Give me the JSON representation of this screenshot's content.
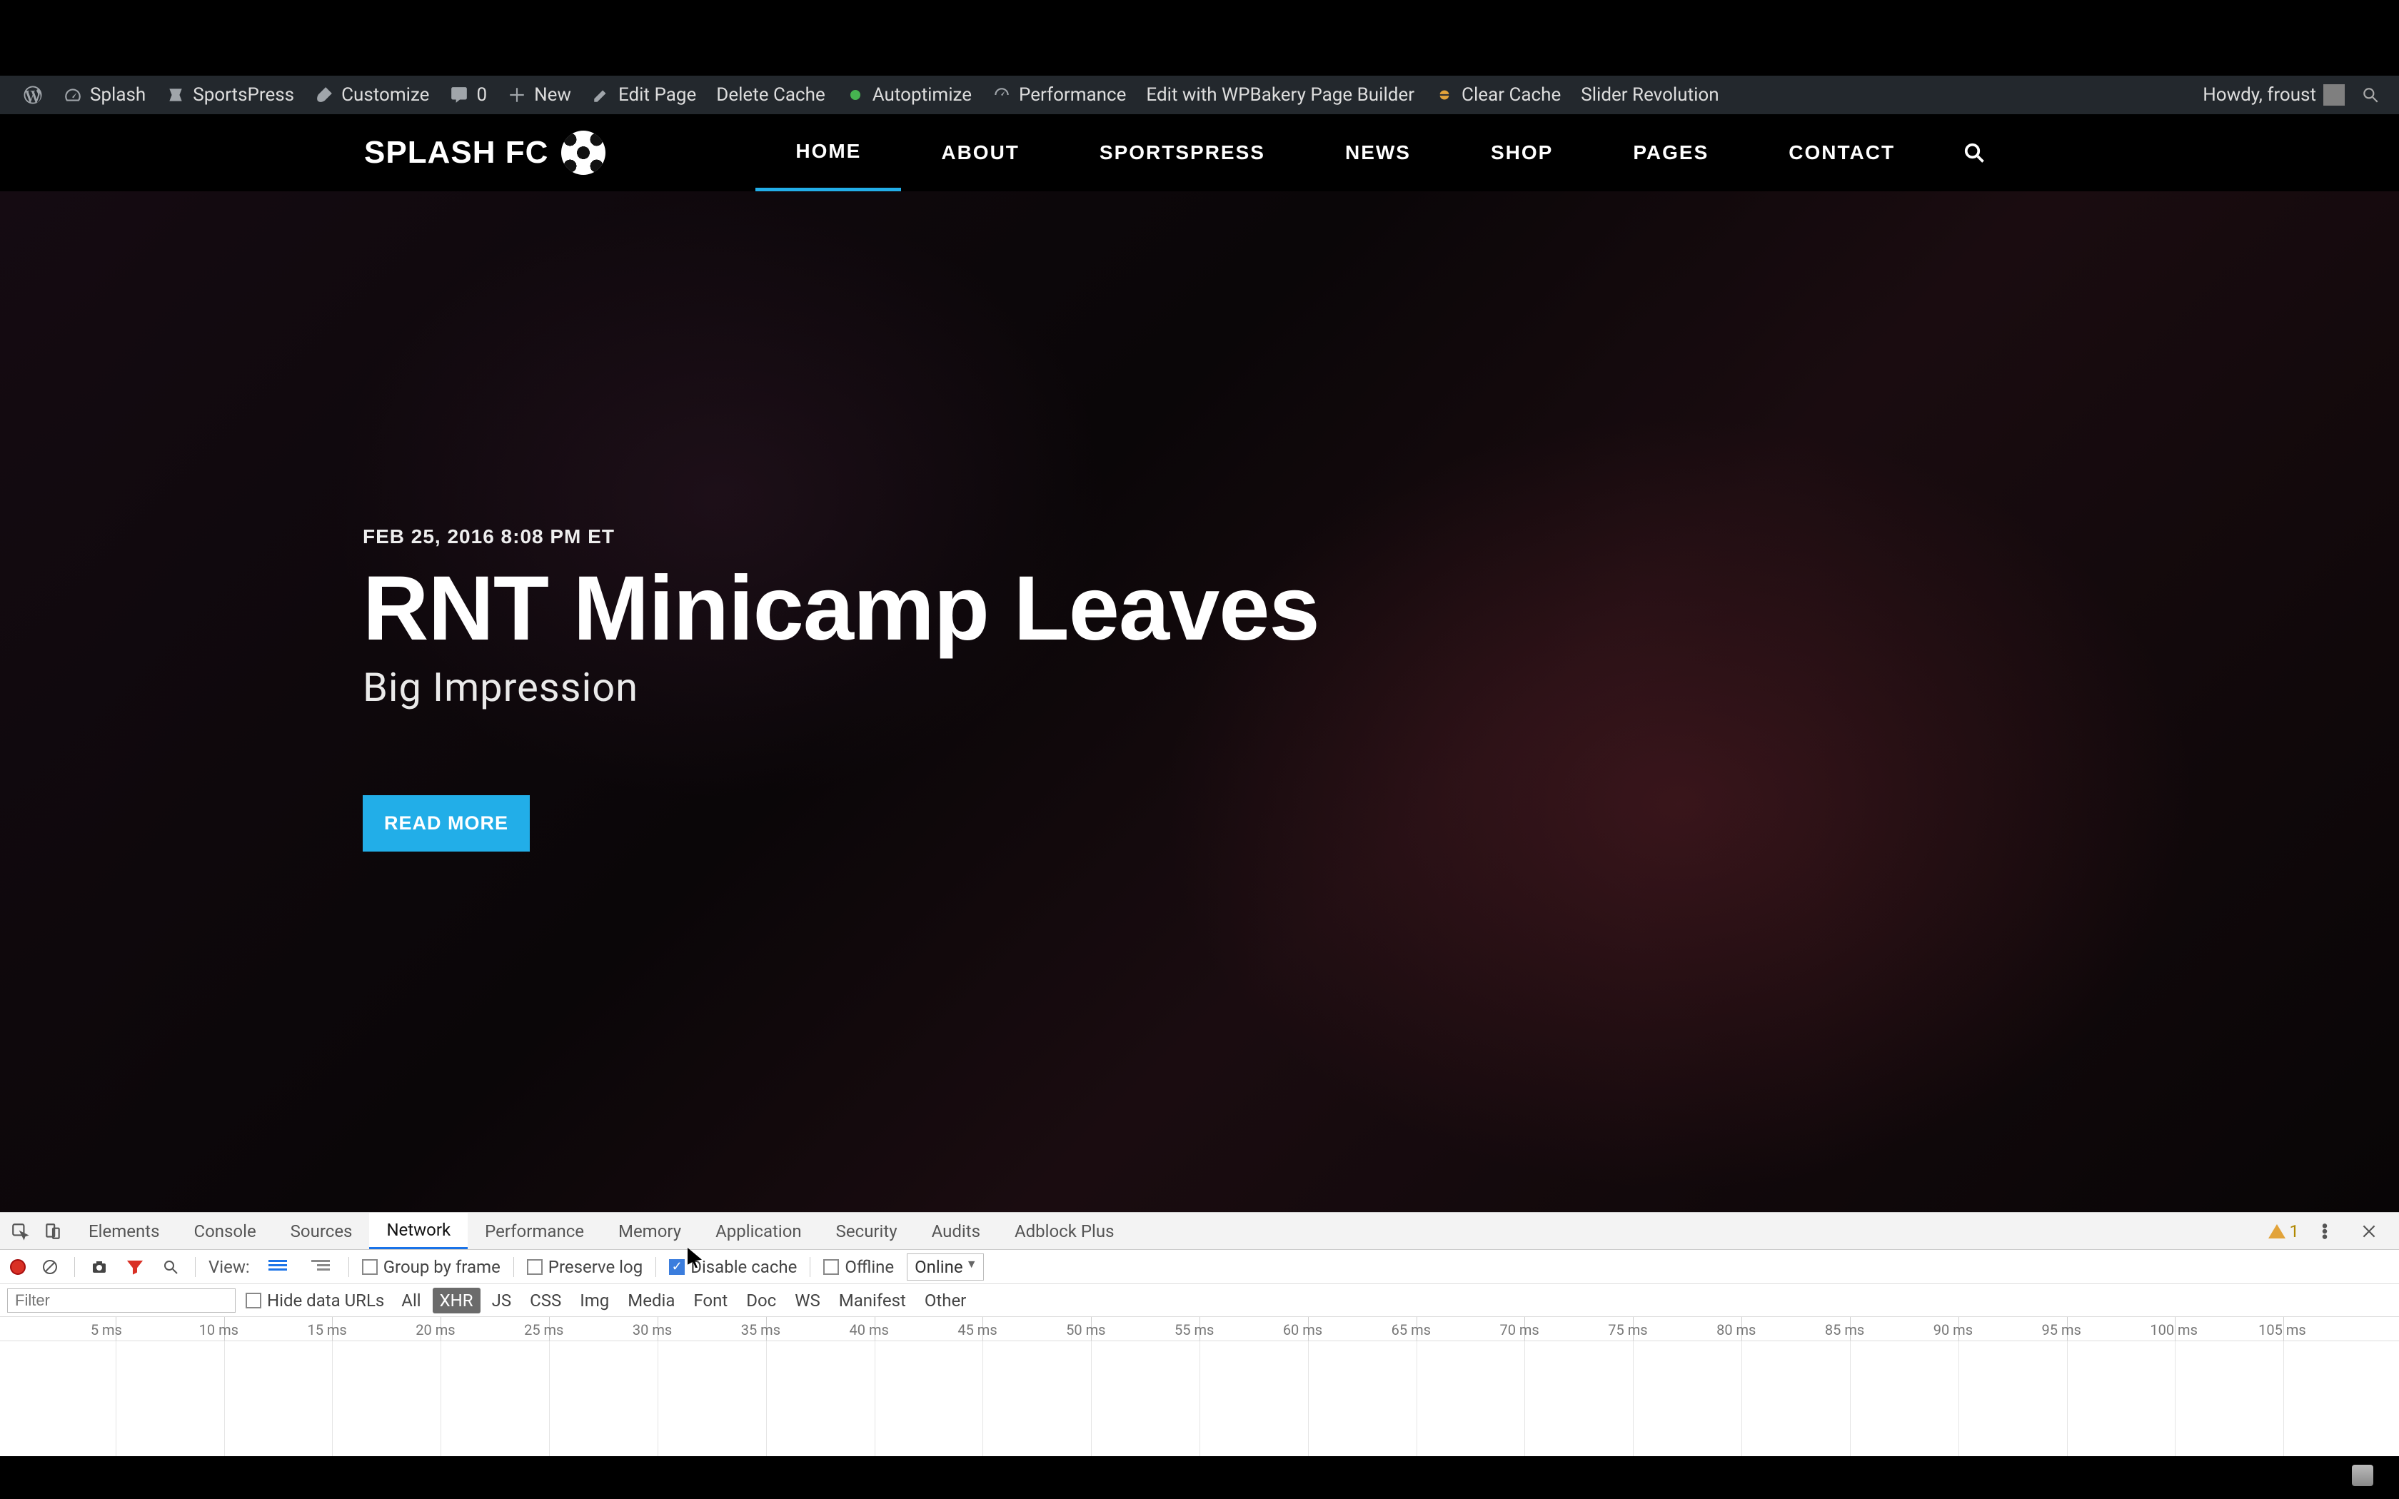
{
  "wp_admin": {
    "site_name": "Splash",
    "sportspress": "SportsPress",
    "customize": "Customize",
    "comments_count": "0",
    "new": "New",
    "edit_page": "Edit Page",
    "delete_cache": "Delete Cache",
    "autoptimize": "Autoptimize",
    "performance": "Performance",
    "wpbakery": "Edit with WPBakery Page Builder",
    "clear_cache": "Clear Cache",
    "slider_rev": "Slider Revolution",
    "howdy": "Howdy, froust"
  },
  "site_header": {
    "logo_text": "SPLASH FC",
    "nav": [
      "HOME",
      "ABOUT",
      "SPORTSPRESS",
      "NEWS",
      "SHOP",
      "PAGES",
      "CONTACT"
    ],
    "active_index": 0
  },
  "hero": {
    "date": "FEB 25, 2016 8:08 PM ET",
    "title": "RNT Minicamp Leaves",
    "subtitle": "Big Impression",
    "button": "READ MORE"
  },
  "devtools": {
    "tabs": [
      "Elements",
      "Console",
      "Sources",
      "Network",
      "Performance",
      "Memory",
      "Application",
      "Security",
      "Audits",
      "Adblock Plus"
    ],
    "active_tab_index": 3,
    "warning_count": "1",
    "net_toolbar": {
      "view_label": "View:",
      "group_by_frame": "Group by frame",
      "preserve_log": "Preserve log",
      "disable_cache": "Disable cache",
      "disable_cache_checked": true,
      "offline": "Offline",
      "throttle": "Online"
    },
    "filter_row": {
      "filter_placeholder": "Filter",
      "hide_data_urls": "Hide data URLs",
      "types": [
        "All",
        "XHR",
        "JS",
        "CSS",
        "Img",
        "Media",
        "Font",
        "Doc",
        "WS",
        "Manifest",
        "Other"
      ],
      "active_type_index": 1
    },
    "timeline_ticks": [
      "5 ms",
      "10 ms",
      "15 ms",
      "20 ms",
      "25 ms",
      "30 ms",
      "35 ms",
      "40 ms",
      "45 ms",
      "50 ms",
      "55 ms",
      "60 ms",
      "65 ms",
      "70 ms",
      "75 ms",
      "80 ms",
      "85 ms",
      "90 ms",
      "95 ms",
      "100 ms",
      "105 ms"
    ]
  }
}
